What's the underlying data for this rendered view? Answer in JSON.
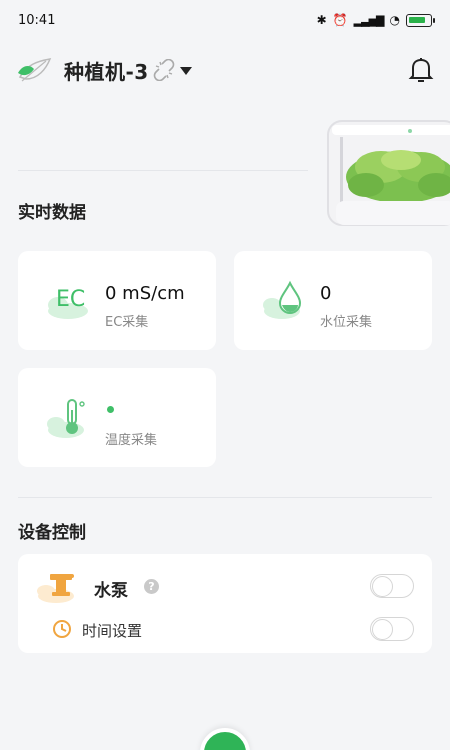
{
  "status_bar": {
    "time": "10:41",
    "icons": [
      "bluetooth-icon",
      "alarm-icon",
      "hd-signal-icon",
      "wifi-icon",
      "battery-charging-icon"
    ]
  },
  "header": {
    "device_name": "种植机-3",
    "logo_icon": "leaf-logo-icon",
    "link_status_icon": "unlinked-icon",
    "dropdown_icon": "caret-down-icon",
    "notification_icon": "bell-icon"
  },
  "realtime": {
    "title": "实时数据",
    "cards": [
      {
        "icon": "ec-icon",
        "icon_text": "EC",
        "value": "0 mS/cm",
        "label": "EC采集"
      },
      {
        "icon": "water-drop-icon",
        "value": "0",
        "label": "水位采集"
      },
      {
        "icon": "thermometer-icon",
        "value": "",
        "label": "温度采集"
      }
    ]
  },
  "control": {
    "title": "设备控制",
    "pump": {
      "icon": "water-pump-icon",
      "label": "水泵",
      "help_icon": "question-icon",
      "help_text": "?",
      "on": false
    },
    "timer": {
      "icon": "clock-icon",
      "label": "时间设置",
      "on": false
    }
  },
  "colors": {
    "accent": "#2fb457",
    "icon_green": "#7fd494",
    "icon_orange": "#f0a540",
    "background": "#f4f5f7"
  }
}
